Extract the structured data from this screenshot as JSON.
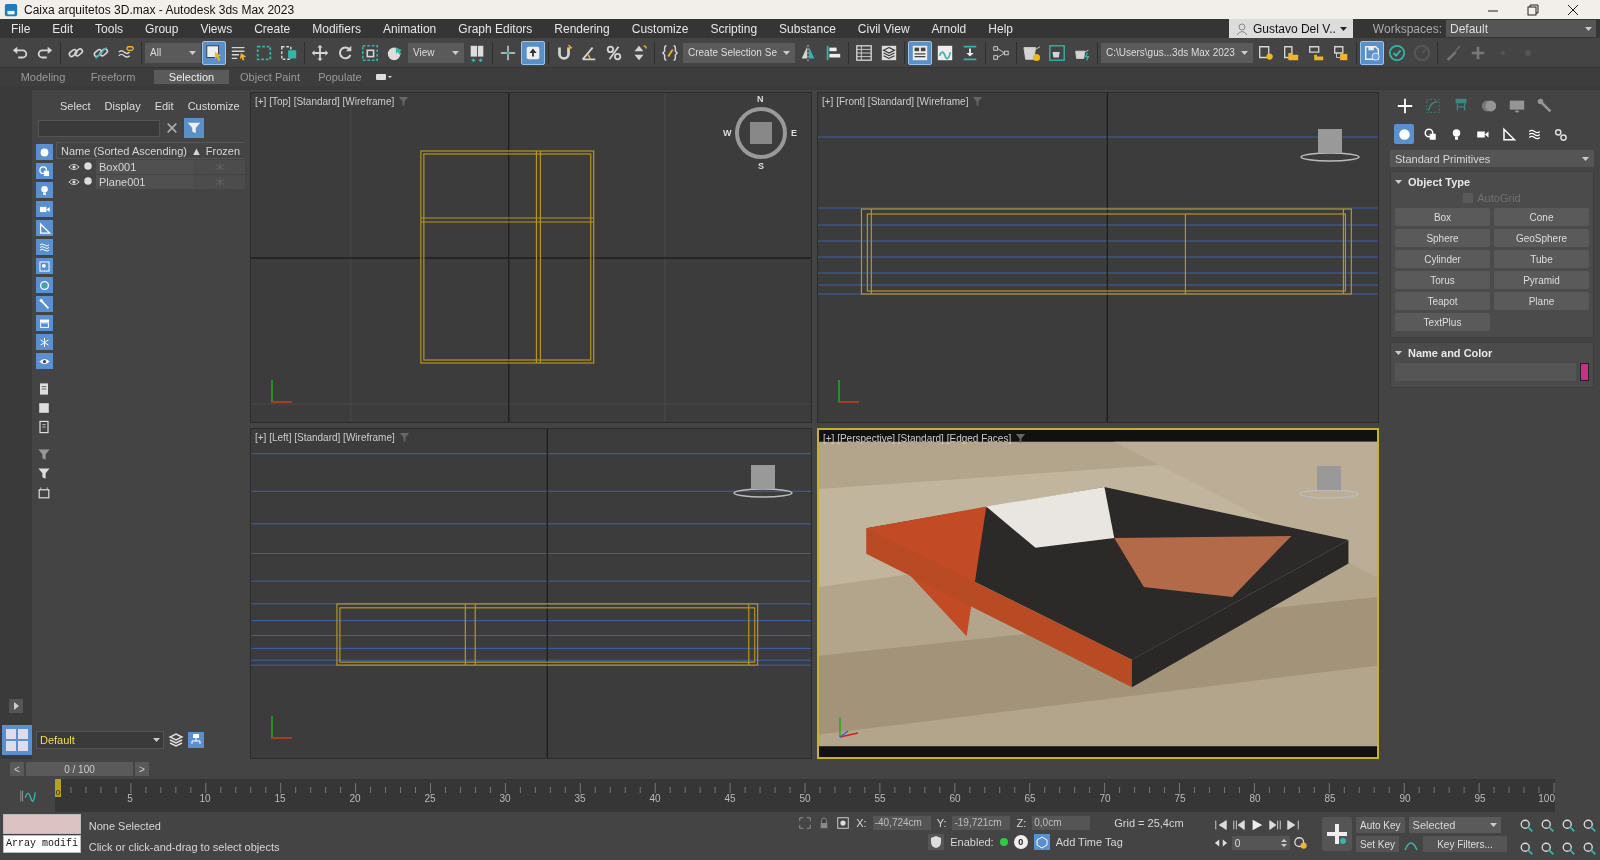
{
  "window": {
    "title": "Caixa arquitetos 3D.max - Autodesk 3ds Max 2023"
  },
  "menu": [
    "File",
    "Edit",
    "Tools",
    "Group",
    "Views",
    "Create",
    "Modifiers",
    "Animation",
    "Graph Editors",
    "Rendering",
    "Customize",
    "Scripting",
    "Substance",
    "Civil View",
    "Arnold",
    "Help"
  ],
  "user": {
    "name": "Gustavo Del V.."
  },
  "workspaces": {
    "label": "Workspaces:",
    "value": "Default"
  },
  "toolbar": [
    {
      "kind": "icon",
      "on": false
    },
    {
      "kind": "icon",
      "on": false
    },
    {
      "kind": "separator"
    },
    {
      "kind": "icon",
      "on": false
    },
    {
      "kind": "icon",
      "on": false
    },
    {
      "kind": "icon",
      "on": false
    },
    {
      "kind": "separator"
    },
    {
      "kind": "dropdown",
      "value": "All"
    },
    {
      "kind": "icon",
      "on": true
    },
    {
      "kind": "icon",
      "on": false
    },
    {
      "kind": "icon",
      "on": false
    },
    {
      "kind": "icon",
      "on": false
    },
    {
      "kind": "separator"
    },
    {
      "kind": "icon",
      "on": false
    },
    {
      "kind": "icon",
      "on": false
    },
    {
      "kind": "icon",
      "on": false
    },
    {
      "kind": "icon",
      "on": false
    },
    {
      "kind": "dropdown",
      "value": "View"
    },
    {
      "kind": "icon",
      "on": false
    },
    {
      "kind": "separator"
    },
    {
      "kind": "icon",
      "on": false
    },
    {
      "kind": "icon",
      "on": true
    },
    {
      "kind": "separator"
    },
    {
      "kind": "icon",
      "on": false
    },
    {
      "kind": "icon",
      "on": false
    },
    {
      "kind": "icon",
      "on": false
    },
    {
      "kind": "icon",
      "on": false
    },
    {
      "kind": "separator"
    },
    {
      "kind": "icon",
      "on": false
    },
    {
      "kind": "dropdown",
      "value": "Create Selection Se"
    },
    {
      "kind": "icon",
      "on": false
    },
    {
      "kind": "icon",
      "on": false
    },
    {
      "kind": "separator"
    },
    {
      "kind": "icon",
      "on": false
    },
    {
      "kind": "icon",
      "on": false
    },
    {
      "kind": "separator"
    },
    {
      "kind": "icon",
      "on": true
    },
    {
      "kind": "icon",
      "on": false
    },
    {
      "kind": "icon",
      "on": false
    },
    {
      "kind": "separator"
    },
    {
      "kind": "icon",
      "on": false
    },
    {
      "kind": "separator"
    },
    {
      "kind": "icon",
      "on": false
    },
    {
      "kind": "icon",
      "on": false
    },
    {
      "kind": "icon",
      "on": false
    },
    {
      "kind": "separator"
    },
    {
      "kind": "dropdown",
      "value": "C:\\Users\\gus...3ds Max 2023"
    },
    {
      "kind": "icon",
      "on": false
    },
    {
      "kind": "icon",
      "on": false
    },
    {
      "kind": "icon",
      "on": false
    },
    {
      "kind": "icon",
      "on": false
    },
    {
      "kind": "separator"
    },
    {
      "kind": "icon",
      "on": true
    },
    {
      "kind": "icon",
      "on": false
    },
    {
      "kind": "icon",
      "on": false
    },
    {
      "kind": "separator"
    },
    {
      "kind": "icon",
      "on": false
    },
    {
      "kind": "icon",
      "on": false
    },
    {
      "kind": "icon",
      "on": false
    },
    {
      "kind": "icon",
      "on": false
    }
  ],
  "ribbon_tabs": [
    {
      "label": "Modeling",
      "selected": false
    },
    {
      "label": "Freeform",
      "selected": false
    },
    {
      "label": "Selection",
      "selected": true
    },
    {
      "label": "Object Paint",
      "selected": false
    },
    {
      "label": "Populate",
      "selected": false
    }
  ],
  "scene_explorer": {
    "menu": [
      "Select",
      "Display",
      "Edit",
      "Customize"
    ],
    "filters": [
      {
        "on": true
      },
      {
        "on": true
      },
      {
        "on": true
      },
      {
        "on": true
      },
      {
        "on": true
      },
      {
        "on": true
      },
      {
        "on": true
      },
      {
        "on": true
      },
      {
        "on": true
      },
      {
        "on": true
      },
      {
        "on": true
      },
      {
        "on": true
      }
    ],
    "columns": [
      "Name (Sorted Ascending)",
      "Frozen"
    ],
    "sort_arrow": "▲",
    "rows": [
      {
        "name": "Box001"
      },
      {
        "name": "Plane001"
      }
    ],
    "layer": "Default"
  },
  "viewports": [
    {
      "kind": "top",
      "label": "[+] [Top] [Standard] [Wireframe]",
      "active": false,
      "compass": {
        "n": "N",
        "e": "E",
        "s": "S",
        "w": "W"
      }
    },
    {
      "kind": "front",
      "label": "[+] [Front] [Standard] [Wireframe]",
      "active": false
    },
    {
      "kind": "left",
      "label": "[+] [Left] [Standard] [Wireframe]",
      "active": false
    },
    {
      "kind": "perspective",
      "label": "[+] [Perspective] [Standard] [Edged Faces]",
      "active": true
    }
  ],
  "command_panel": {
    "tabs": [
      {
        "selected": true
      },
      {
        "selected": false
      },
      {
        "selected": false
      },
      {
        "selected": false
      },
      {
        "selected": false
      },
      {
        "selected": false
      }
    ],
    "categories": [
      {
        "selected": true
      },
      {
        "selected": false
      },
      {
        "selected": false
      },
      {
        "selected": false
      },
      {
        "selected": false
      },
      {
        "selected": false
      },
      {
        "selected": false
      }
    ],
    "dropdown": "Standard Primitives",
    "object_type": {
      "title": "Object Type",
      "autogrid": {
        "label": "AutoGrid",
        "checked": false,
        "disabled": true
      },
      "buttons": [
        "Box",
        "Cone",
        "Sphere",
        "GeoSphere",
        "Cylinder",
        "Tube",
        "Torus",
        "Pyramid",
        "Teapot",
        "Plane",
        "TextPlus"
      ]
    },
    "name_and_color": {
      "title": "Name and Color",
      "color": "#c8318a"
    }
  },
  "timeline": {
    "prev": "<",
    "position": "0 / 100",
    "next": ">",
    "current_frame": "0",
    "ticks": [
      "5",
      "10",
      "15",
      "20",
      "25",
      "30",
      "35",
      "40",
      "45",
      "50",
      "55",
      "60",
      "65",
      "70",
      "75",
      "80",
      "85",
      "90",
      "95",
      "100"
    ]
  },
  "status": {
    "listener_input": "Array modifi",
    "selection": "None Selected",
    "prompt": "Click or click-and-drag to select objects",
    "coords": [
      {
        "label": "X:",
        "value": "-40,724cm"
      },
      {
        "label": "Y:",
        "value": "-19,721cm"
      },
      {
        "label": "Z:",
        "value": "0,0cm"
      }
    ],
    "grid": "Grid = 25,4cm",
    "time_tag": {
      "label": "Enabled:",
      "enabled": true,
      "count": "0",
      "add": "Add Time Tag"
    },
    "auto_key": "Auto Key",
    "key_mode": "Selected",
    "set_key": "Set Key",
    "frame": "0",
    "key_filters": "Key Filters..."
  }
}
